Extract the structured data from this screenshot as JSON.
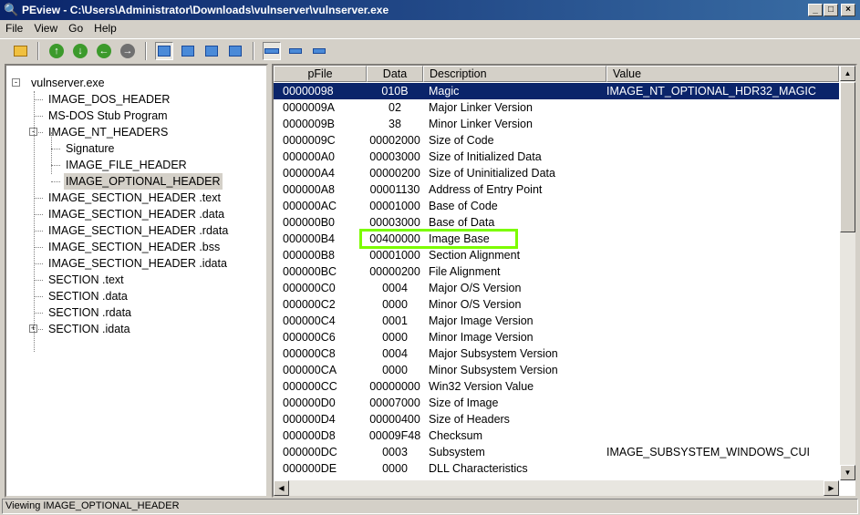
{
  "window": {
    "title": "PEview - C:\\Users\\Administrator\\Downloads\\vulnserver\\vulnserver.exe"
  },
  "menu": [
    "File",
    "View",
    "Go",
    "Help"
  ],
  "tree": [
    {
      "label": "vulnserver.exe",
      "level": 0,
      "expander": "-"
    },
    {
      "label": "IMAGE_DOS_HEADER",
      "level": 1
    },
    {
      "label": "MS-DOS Stub Program",
      "level": 1
    },
    {
      "label": "IMAGE_NT_HEADERS",
      "level": 1,
      "expander": "-"
    },
    {
      "label": "Signature",
      "level": 2
    },
    {
      "label": "IMAGE_FILE_HEADER",
      "level": 2
    },
    {
      "label": "IMAGE_OPTIONAL_HEADER",
      "level": 2,
      "selected": true
    },
    {
      "label": "IMAGE_SECTION_HEADER .text",
      "level": 1
    },
    {
      "label": "IMAGE_SECTION_HEADER .data",
      "level": 1
    },
    {
      "label": "IMAGE_SECTION_HEADER .rdata",
      "level": 1
    },
    {
      "label": "IMAGE_SECTION_HEADER .bss",
      "level": 1
    },
    {
      "label": "IMAGE_SECTION_HEADER .idata",
      "level": 1
    },
    {
      "label": "SECTION .text",
      "level": 1
    },
    {
      "label": "SECTION .data",
      "level": 1
    },
    {
      "label": "SECTION .rdata",
      "level": 1
    },
    {
      "label": "SECTION .idata",
      "level": 1,
      "expander": "+"
    }
  ],
  "columns": [
    "pFile",
    "Data",
    "Description",
    "Value"
  ],
  "rows": [
    [
      "00000098",
      "010B",
      "Magic",
      "IMAGE_NT_OPTIONAL_HDR32_MAGIC"
    ],
    [
      "0000009A",
      "02",
      "Major Linker Version",
      ""
    ],
    [
      "0000009B",
      "38",
      "Minor Linker Version",
      ""
    ],
    [
      "0000009C",
      "00002000",
      "Size of Code",
      ""
    ],
    [
      "000000A0",
      "00003000",
      "Size of Initialized Data",
      ""
    ],
    [
      "000000A4",
      "00000200",
      "Size of Uninitialized Data",
      ""
    ],
    [
      "000000A8",
      "00001130",
      "Address of Entry Point",
      ""
    ],
    [
      "000000AC",
      "00001000",
      "Base of Code",
      ""
    ],
    [
      "000000B0",
      "00003000",
      "Base of Data",
      ""
    ],
    [
      "000000B4",
      "00400000",
      "Image Base",
      ""
    ],
    [
      "000000B8",
      "00001000",
      "Section Alignment",
      ""
    ],
    [
      "000000BC",
      "00000200",
      "File Alignment",
      ""
    ],
    [
      "000000C0",
      "0004",
      "Major O/S Version",
      ""
    ],
    [
      "000000C2",
      "0000",
      "Minor O/S Version",
      ""
    ],
    [
      "000000C4",
      "0001",
      "Major Image Version",
      ""
    ],
    [
      "000000C6",
      "0000",
      "Minor Image Version",
      ""
    ],
    [
      "000000C8",
      "0004",
      "Major Subsystem Version",
      ""
    ],
    [
      "000000CA",
      "0000",
      "Minor Subsystem Version",
      ""
    ],
    [
      "000000CC",
      "00000000",
      "Win32 Version Value",
      ""
    ],
    [
      "000000D0",
      "00007000",
      "Size of Image",
      ""
    ],
    [
      "000000D4",
      "00000400",
      "Size of Headers",
      ""
    ],
    [
      "000000D8",
      "00009F48",
      "Checksum",
      ""
    ],
    [
      "000000DC",
      "0003",
      "Subsystem",
      "IMAGE_SUBSYSTEM_WINDOWS_CUI"
    ],
    [
      "000000DE",
      "0000",
      "DLL Characteristics",
      ""
    ]
  ],
  "status": "Viewing IMAGE_OPTIONAL_HEADER"
}
